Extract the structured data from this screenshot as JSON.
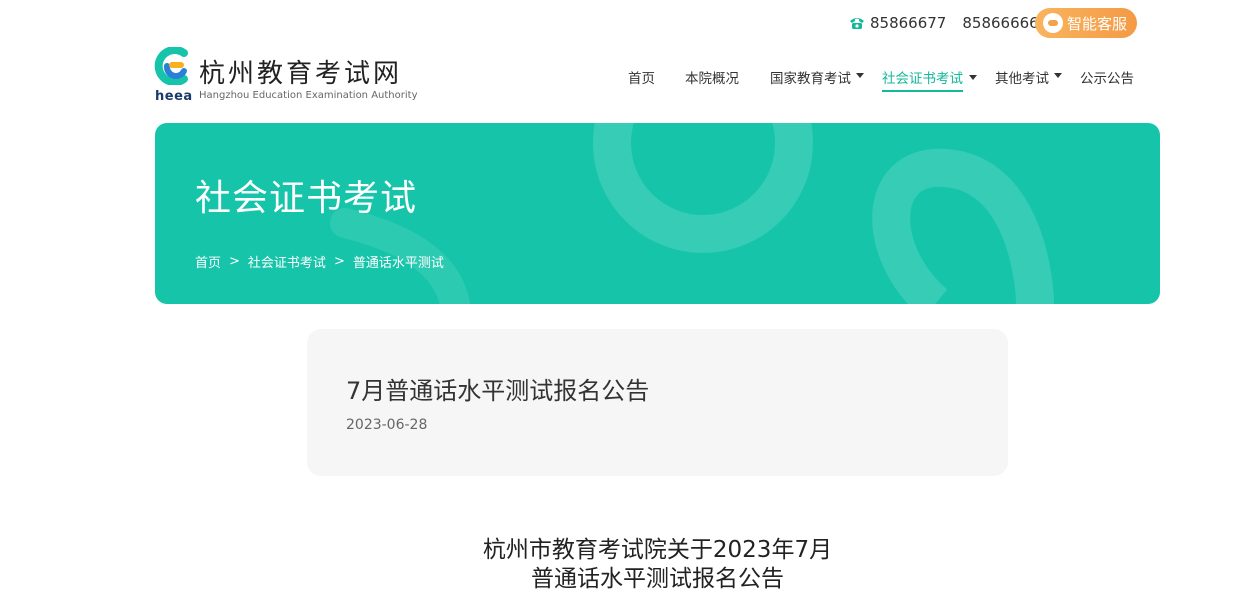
{
  "topbar": {
    "phones": [
      "85866677",
      "85866666"
    ],
    "service_label": "智能客服",
    "icon_phone": "phone-icon",
    "icon_service": "chat-icon"
  },
  "logo": {
    "abbr": "heea",
    "name_cn": "杭州教育考试网",
    "name_en": "Hangzhou Education Examination Authority",
    "colors": {
      "teal": "#16c4aa",
      "blue": "#2a7fd9",
      "orange": "#f7b11e"
    }
  },
  "nav": {
    "items": [
      {
        "label": "首页",
        "dropdown": false,
        "active": false
      },
      {
        "label": "本院概况",
        "dropdown": false,
        "active": false
      },
      {
        "label": "国家教育考试",
        "dropdown": true,
        "active": false
      },
      {
        "label": "社会证书考试",
        "dropdown": true,
        "active": true
      },
      {
        "label": "其他考试",
        "dropdown": true,
        "active": false
      },
      {
        "label": "公示公告",
        "dropdown": false,
        "active": false
      }
    ]
  },
  "banner": {
    "title": "社会证书考试",
    "breadcrumb": [
      "首页",
      "社会证书考试",
      "普通话水平测试"
    ],
    "separator": ">",
    "color": "#16c4aa"
  },
  "article": {
    "title": "7月普通话水平测试报名公告",
    "date": "2023-06-28"
  },
  "document": {
    "heading_line1": "杭州市教育考试院关于2023年7月",
    "heading_line2": "普通话水平测试报名公告"
  },
  "colors": {
    "accent": "#14b89a",
    "service_button": "#f49a45",
    "card_bg": "#f6f6f6"
  }
}
